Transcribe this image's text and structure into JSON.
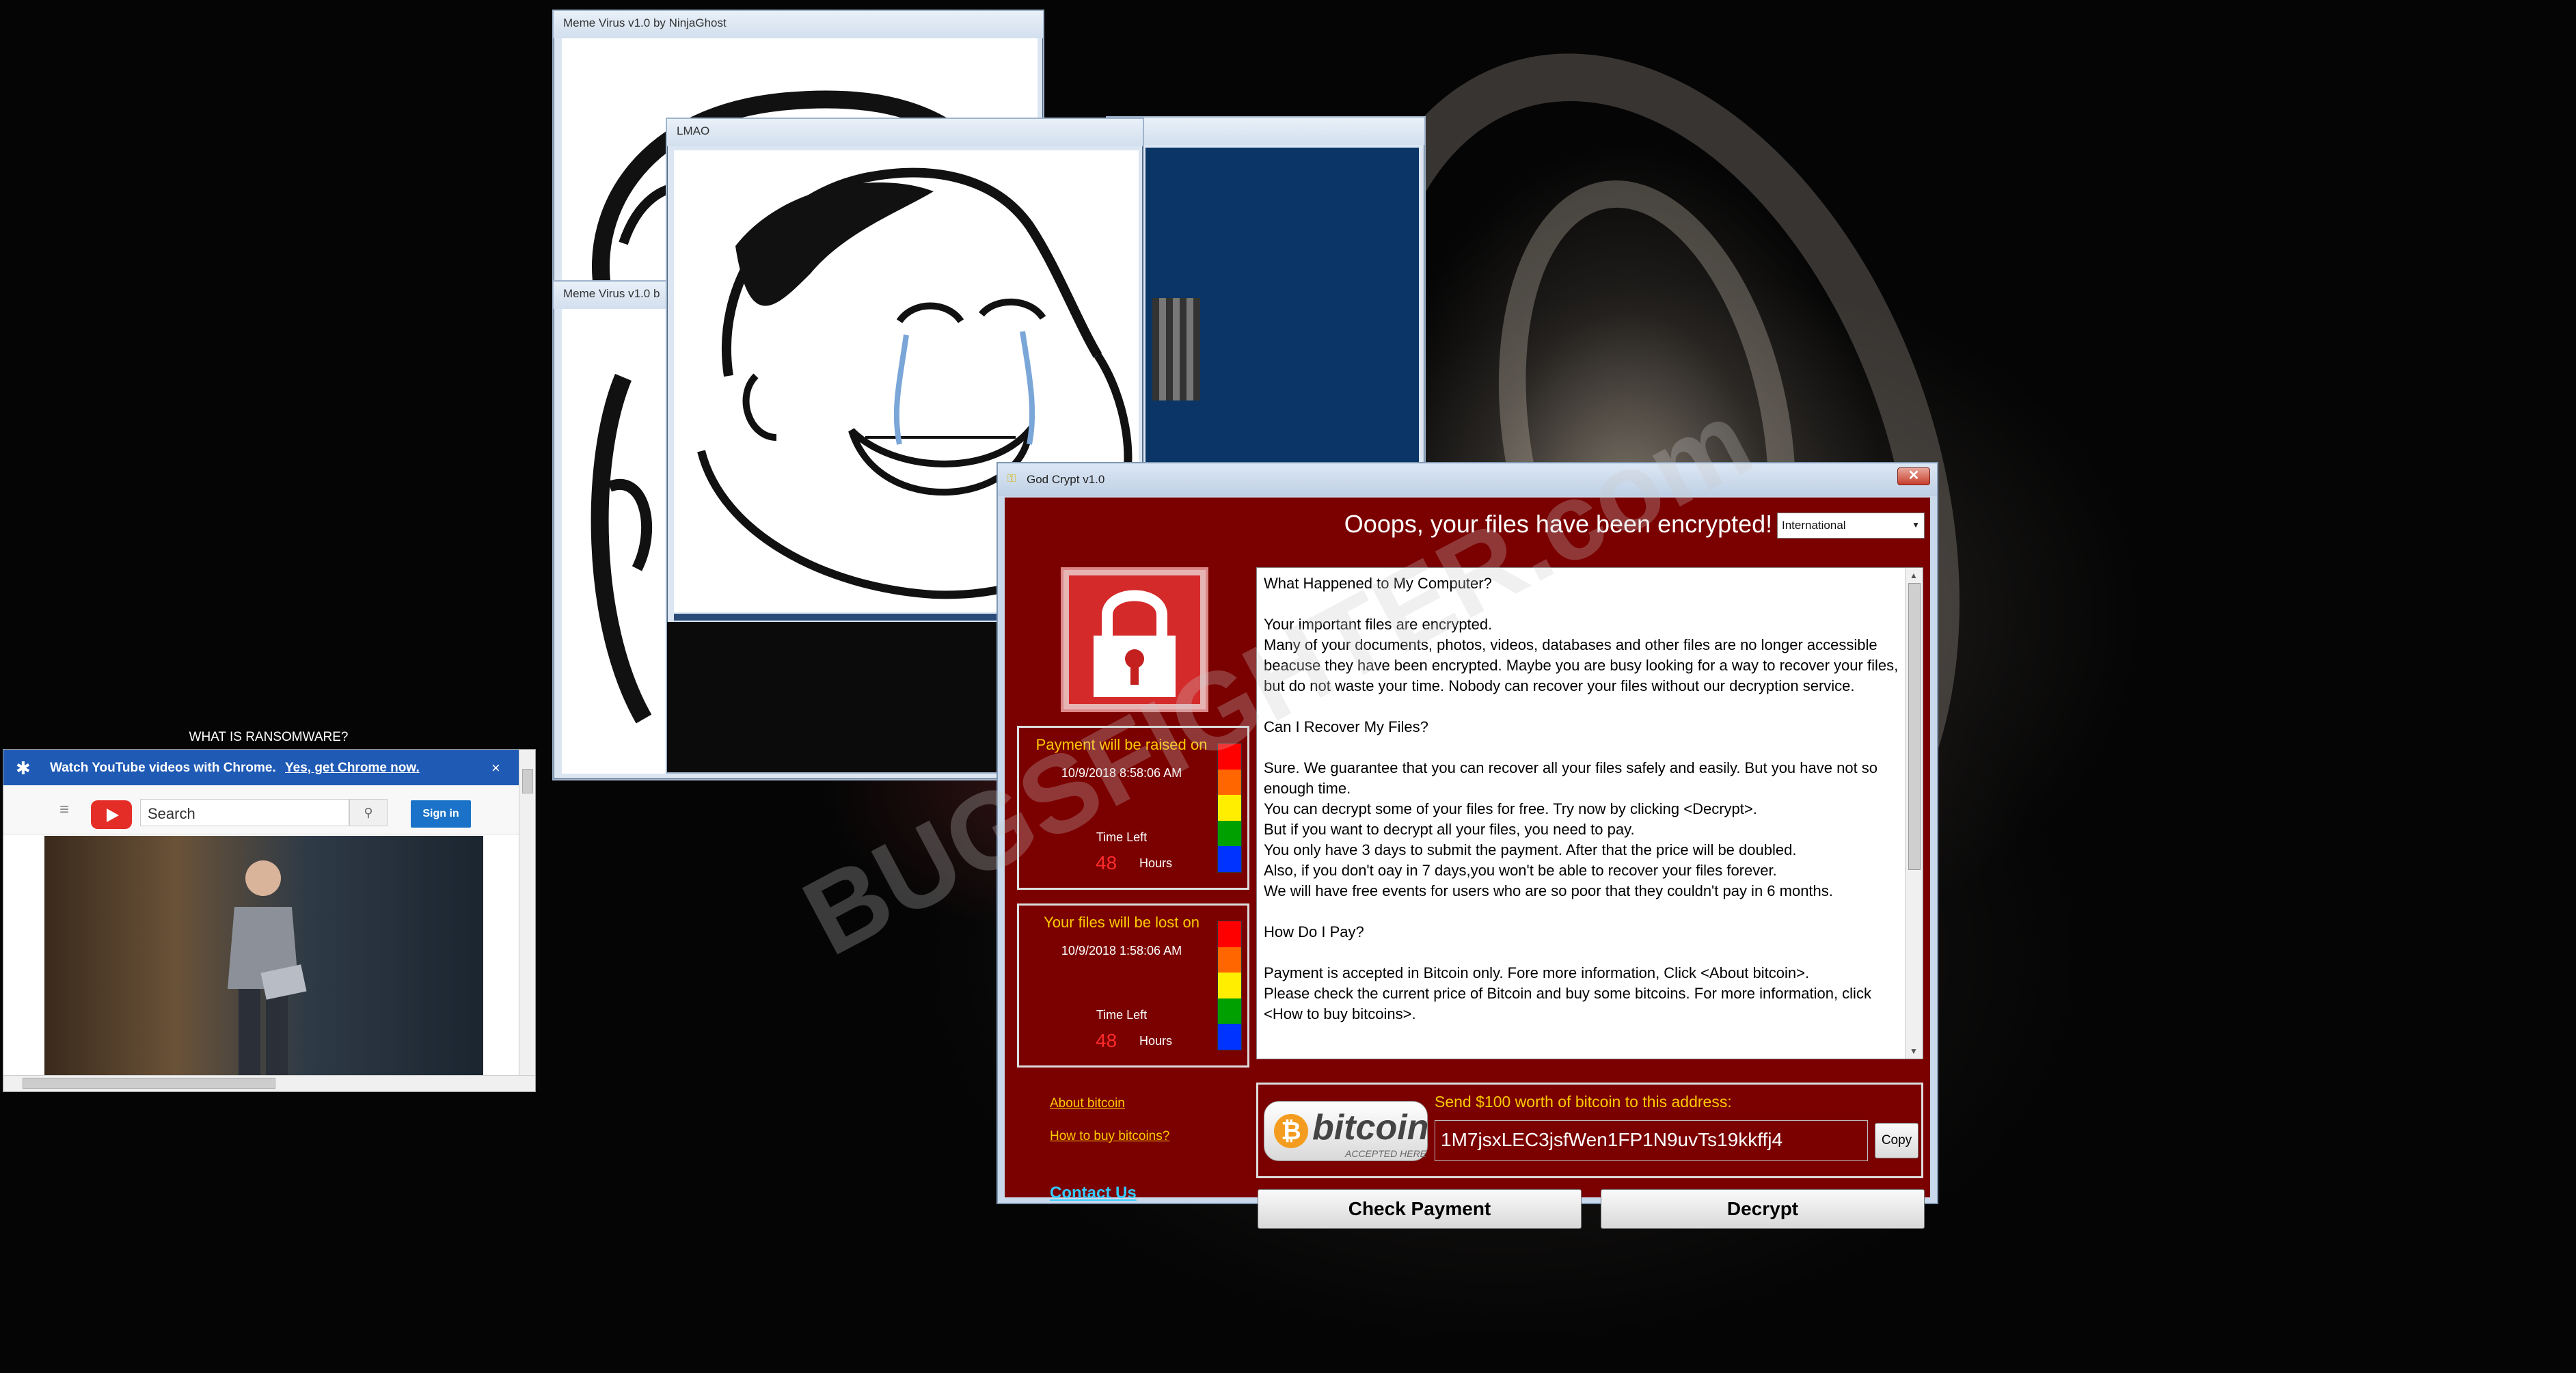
{
  "windows": {
    "meme1": {
      "title": "Meme Virus v1.0 by NinjaGhost"
    },
    "meme2": {
      "title": "Meme Virus v1.0 b"
    },
    "lmao": {
      "title": "LMAO"
    }
  },
  "godcrypt": {
    "title": "God Crypt v1.0",
    "headline": "Ooops, your files have been encrypted!",
    "language": "International",
    "timer1": {
      "caption": "Payment will be raised on",
      "date": "10/9/2018 8:58:06 AM",
      "time_left_label": "Time Left",
      "number": "48",
      "unit": "Hours"
    },
    "timer2": {
      "caption": "Your files will be lost on",
      "date": "10/9/2018 1:58:06 AM",
      "time_left_label": "Time Left",
      "number": "48",
      "unit": "Hours"
    },
    "message": [
      "What Happened to My Computer?",
      "",
      "Your important files are encrypted.",
      "Many of your documents, photos, videos, databases and other files are no longer accessible beacuse they have been encrypted. Maybe you are busy looking for a way to recover your files, but do not waste your time. Nobody can recover your files without our decryption service.",
      "",
      "Can I Recover My Files?",
      "",
      "Sure. We guarantee that you can recover all your files safely and easily. But you have not so enough time.",
      "You can decrypt some of your files for free. Try now by clicking <Decrypt>.",
      "But if you want to decrypt all your files, you need to pay.",
      "You only have 3 days to submit the payment. After that the price will be doubled.",
      "Also, if you don't oay in 7 days,you won't be able to recover your files forever.",
      "We will have free events for users who are so poor that they couldn't pay in 6 months.",
      "",
      "How Do I Pay?",
      "",
      "Payment is accepted in Bitcoin only. Fore more information, Click <About bitcoin>.",
      "Please check the current price of Bitcoin and buy some bitcoins. For more information, click <How to buy bitcoins>."
    ],
    "bitcoin_logo_word": "bitcoin",
    "bitcoin_logo_sub": "ACCEPTED HERE",
    "send_label": "Send $100 worth of bitcoin to this address:",
    "address": "1M7jsxLEC3jsfWen1FP1N9uvTs19kkffj4",
    "copy_label": "Copy",
    "link_about": "About bitcoin",
    "link_howto": "How to buy bitcoins?",
    "contact": "Contact Us",
    "check_payment": "Check Payment",
    "decrypt": "Decrypt"
  },
  "youtube": {
    "caption": "WHAT IS RANSOMWARE?",
    "banner_text": "Watch YouTube videos with Chrome.",
    "banner_cta": "Yes, get Chrome now.",
    "banner_close": "×",
    "search_placeholder": "Search",
    "signin": "Sign in"
  },
  "watermark": "BUGSFIGHTER.com",
  "colors": {
    "ransom_bg": "#7b0000",
    "caption_yellow": "#ffcc00",
    "contact_blue": "#33ccff",
    "timer_bars": [
      "#ff0000",
      "#ff6600",
      "#ffee00",
      "#00a000",
      "#0033ff"
    ]
  }
}
